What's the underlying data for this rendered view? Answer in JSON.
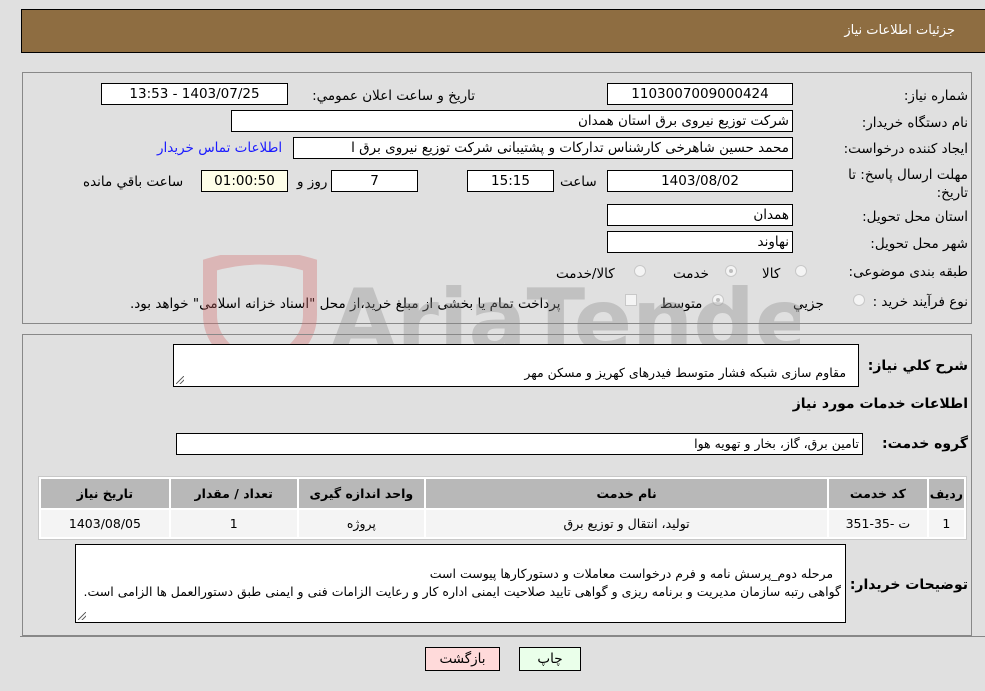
{
  "header": {
    "title": "جزئیات اطلاعات نیاز"
  },
  "form": {
    "need_number": {
      "label": "شماره نیاز:",
      "value": "1103007009000424"
    },
    "announce_datetime": {
      "label": "تاریخ و ساعت اعلان عمومي:",
      "value": "1403/07/25 - 13:53"
    },
    "buyer_org": {
      "label": "نام دستگاه خریدار:",
      "value": "شرکت توزیع نیروی برق استان همدان"
    },
    "requester": {
      "label": "ایجاد کننده درخواست:",
      "value": "محمد حسین شاهرخی کارشناس تدارکات و پشتیبانی شرکت توزیع نیروی برق ا"
    },
    "buyer_contact_link": "اطلاعات تماس خریدار",
    "deadline": {
      "label": "مهلت ارسال پاسخ: تا تاریخ:",
      "date": "1403/08/02",
      "time_label": "ساعت",
      "time": "15:15",
      "days": "7",
      "days_label": "روز و",
      "remaining": "01:00:50",
      "remaining_label": "ساعت باقي مانده"
    },
    "province": {
      "label": "استان محل تحویل:",
      "value": "همدان"
    },
    "city": {
      "label": "شهر محل تحویل:",
      "value": "نهاوند"
    },
    "category": {
      "label": "طبقه بندی موضوعی:",
      "options": [
        "کالا",
        "خدمت",
        "کالا/خدمت"
      ],
      "selected": "خدمت"
    },
    "purchase_type": {
      "label": "نوع فرآیند خرید :",
      "options": [
        "جزيي",
        "متوسط"
      ],
      "selected": "متوسط",
      "treasury_note": "پرداخت تمام یا بخشی از مبلغ خرید،از محل \"اسناد خزانه اسلامی\" خواهد بود."
    }
  },
  "details": {
    "general_desc": {
      "label": "شرح کلي نیاز:",
      "value": "مقاوم سازی شبکه فشار متوسط فیدرهای کهریز و مسکن مهر"
    },
    "services_title": "اطلاعات خدمات مورد نیاز",
    "service_group": {
      "label": "گروه خدمت:",
      "value": "تامین برق، گاز، بخار و تهویه هوا"
    },
    "table": {
      "headers": [
        "ردیف",
        "کد خدمت",
        "نام خدمت",
        "واحد اندازه گیری",
        "تعداد / مقدار",
        "تاریخ نیاز"
      ],
      "rows": [
        [
          "1",
          "ت -35-351",
          "تولید، انتقال و توزیع برق",
          "پروژه",
          "1",
          "1403/08/05"
        ]
      ]
    },
    "buyer_notes": {
      "label": "توضیحات خریدار:",
      "value": "مرحله دوم_پرسش نامه و فرم درخواست معاملات و دستورکارها پیوست است\nگواهی رتبه سازمان مدیریت و برنامه ریزی و گواهی تایید صلاحیت ایمنی اداره کار و رعایت الزامات فنی و ایمنی طبق دستورالعمل ها الزامی است."
    }
  },
  "buttons": {
    "print": "چاپ",
    "back": "بازگشت"
  },
  "watermark": {
    "text": "AriaTender.neT"
  }
}
